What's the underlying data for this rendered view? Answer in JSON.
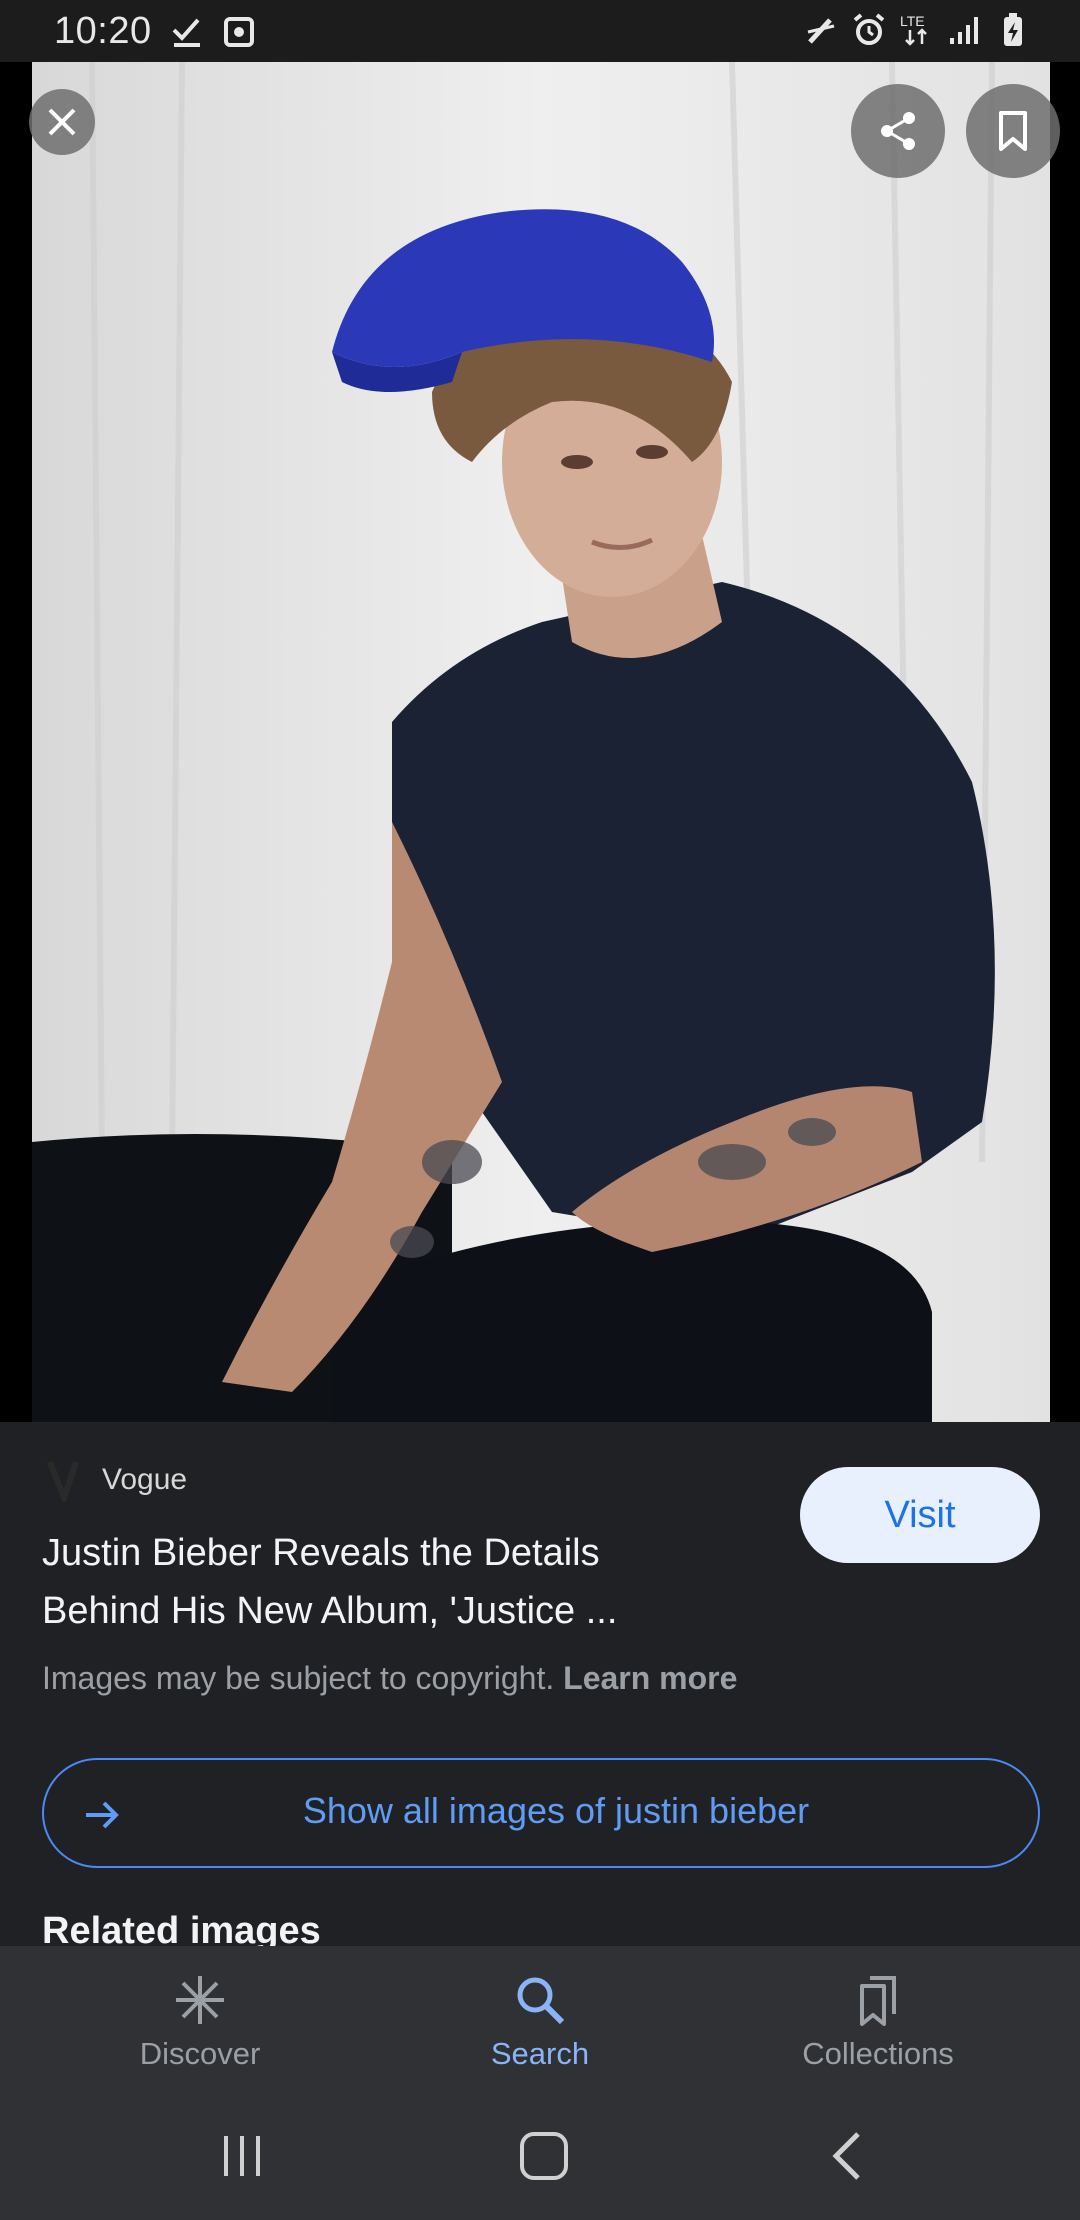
{
  "status_bar": {
    "time": "10:20",
    "left_icons": [
      "download-done-icon",
      "screenshot-icon"
    ],
    "right_icons": [
      "stylus-off-icon",
      "alarm-icon",
      "lte-icon",
      "signal-icon",
      "battery-charging-icon"
    ],
    "network_label": "LTE"
  },
  "viewer": {
    "actions": [
      "close-icon",
      "share-icon",
      "bookmark-icon"
    ]
  },
  "result": {
    "source": "Vogue",
    "title": "Justin Bieber Reveals the Details Behind His New Album, 'Justice ...",
    "visit_label": "Visit",
    "copyright_text": "Images may be subject to copyright.",
    "learn_more": "Learn more",
    "show_all_label": "Show all images of justin bieber",
    "related_heading": "Related images"
  },
  "bottom_nav": {
    "items": [
      {
        "label": "Discover",
        "icon": "asterisk-icon"
      },
      {
        "label": "Search",
        "icon": "search-icon",
        "active": true
      },
      {
        "label": "Collections",
        "icon": "collections-icon"
      }
    ]
  },
  "colors": {
    "background": "#202124",
    "accent": "#8ab4f8",
    "visit_bg": "#e8f0fe",
    "visit_text": "#1a73e8"
  }
}
